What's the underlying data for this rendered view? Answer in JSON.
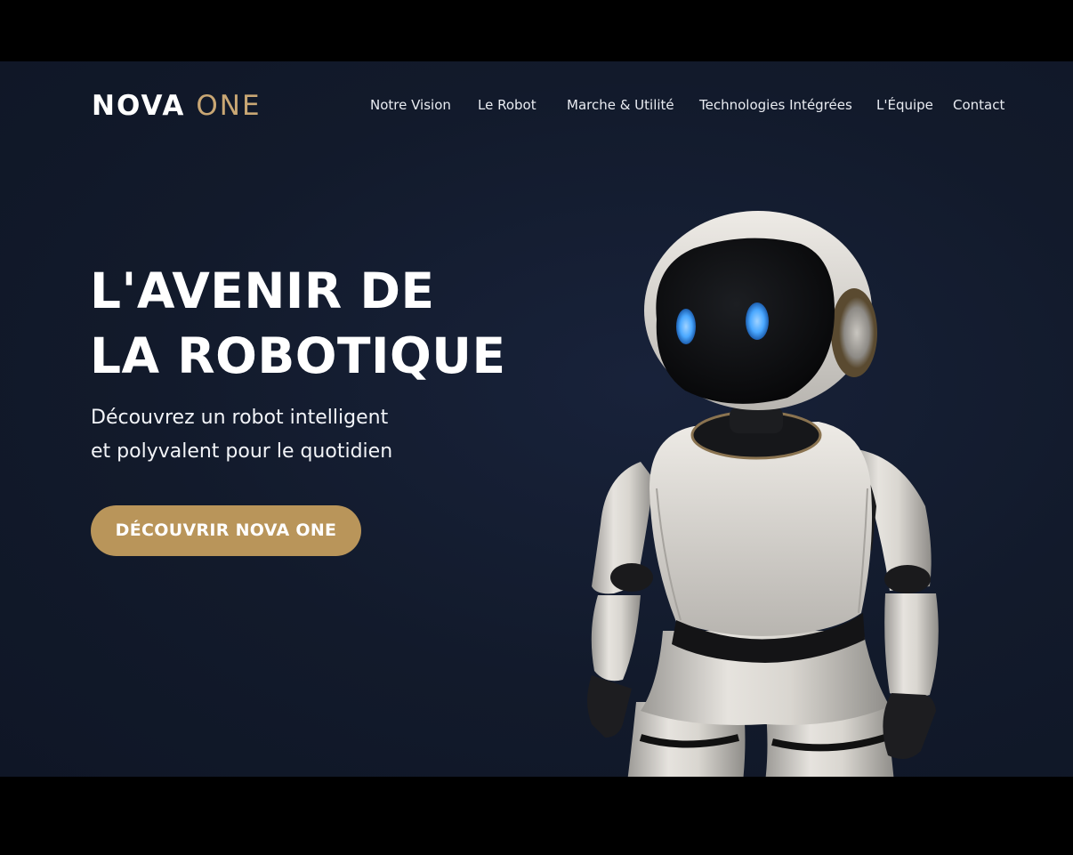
{
  "brand": {
    "name_part1": "NOVA",
    "name_part2": "ONE",
    "accent_color": "#c9a774"
  },
  "nav": {
    "items": [
      {
        "label": "Notre Vision"
      },
      {
        "label": "Le Robot"
      },
      {
        "label": "Marche & Utilité"
      },
      {
        "label": "Technologies Intégrées"
      },
      {
        "label": "L'Équipe"
      },
      {
        "label": "Contact"
      }
    ]
  },
  "hero": {
    "title_line1": "L'AVENIR DE",
    "title_line2": "LA ROBOTIQUE",
    "subtitle_line1": "Découvrez un robot intelligent",
    "subtitle_line2": "et polyvalent pour le quotidien",
    "cta_label": "DÉCOUVRIR NOVA ONE",
    "cta_color": "#b9955a"
  },
  "colors": {
    "background": "#121a2b",
    "letterbox": "#000000",
    "robot_eye": "#4aa8ff"
  }
}
